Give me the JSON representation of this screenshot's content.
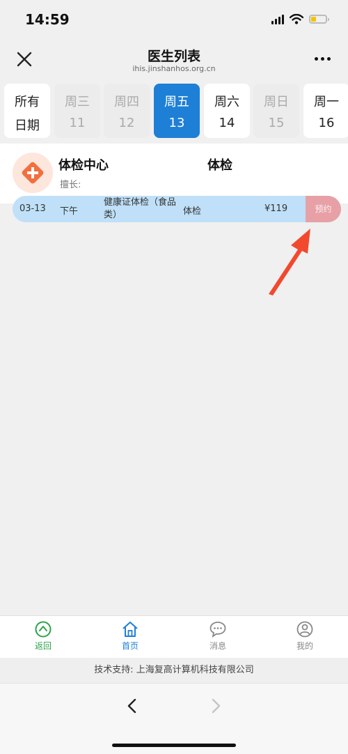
{
  "status": {
    "time": "14:59"
  },
  "header": {
    "title": "医生列表",
    "url": "ihis.jinshanhos.org.cn"
  },
  "date_tabs": [
    {
      "weekday": "所有",
      "date": "日期",
      "state": "available"
    },
    {
      "weekday": "周三",
      "date": "11",
      "state": "disabled"
    },
    {
      "weekday": "周四",
      "date": "12",
      "state": "disabled"
    },
    {
      "weekday": "周五",
      "date": "13",
      "state": "selected"
    },
    {
      "weekday": "周六",
      "date": "14",
      "state": "available"
    },
    {
      "weekday": "周日",
      "date": "15",
      "state": "disabled"
    },
    {
      "weekday": "周一",
      "date": "16",
      "state": "available"
    }
  ],
  "doctor": {
    "name": "体检中心",
    "department": "体检",
    "specialty": "擅长:"
  },
  "slot": {
    "date": "03-13",
    "period": "下午",
    "item": "健康证体检（食品类）",
    "type": "体检",
    "price": "¥119",
    "book_label": "预约"
  },
  "tabbar": {
    "back": "返回",
    "home": "首页",
    "messages": "消息",
    "mine": "我的"
  },
  "footer": {
    "support": "技术支持: 上海复高计算机科技有限公司"
  },
  "colors": {
    "accent": "#1e7fd6",
    "slot_bg": "#bfe0f8",
    "book_button": "#e7a1a6",
    "arrow": "#f2492e",
    "back_green": "#2aa44a"
  }
}
